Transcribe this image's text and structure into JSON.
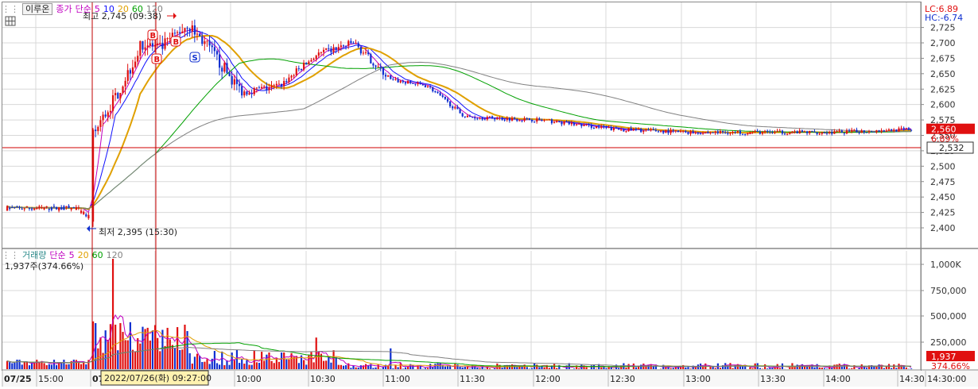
{
  "price_header": {
    "grip": "⋮⋮",
    "tab_label": "이루온",
    "close_label": "종가",
    "ma_label": "단순",
    "periods": [
      "5",
      "10",
      "20",
      "60",
      "120"
    ],
    "period_colors": [
      "#c000c0",
      "#1010ff",
      "#e0a000",
      "#00a000",
      "#808080"
    ],
    "grid_icon_name": "table-icon"
  },
  "corner": {
    "lc": "LC:6.89",
    "hc": "HC:-6.74"
  },
  "annotations": {
    "high": "최고 2,745 (09:38)",
    "low": "최저 2,395 (15:30)",
    "markers": [
      "B",
      "B",
      "B",
      "S"
    ]
  },
  "price_axis": {
    "ticks": [
      "2,725",
      "2,700",
      "2,675",
      "2,650",
      "2,625",
      "2,600",
      "2,575",
      "2,550",
      "2,525",
      "2,500",
      "2,475",
      "2,450",
      "2,425",
      "2,400"
    ],
    "current_price": "2,560",
    "current_pct": "6.89%",
    "crosshair_price": "2,532"
  },
  "volume_header": {
    "label": "거래량",
    "ma_label": "단순",
    "periods": [
      "5",
      "20",
      "60",
      "120"
    ],
    "period_colors": [
      "#c000c0",
      "#e0a000",
      "#00a000",
      "#808080"
    ],
    "current": "1,937주(374.66%)"
  },
  "volume_axis": {
    "ticks": [
      "1,000K",
      "750,000",
      "500,000",
      "250,000"
    ],
    "current_value": "1,937",
    "current_pct": "374.66%"
  },
  "time_axis": {
    "labels": [
      "07/25",
      "15:00",
      "07",
      "10:00",
      "10:30",
      "11:00",
      "11:30",
      "12:00",
      "12:30",
      "13:00",
      "13:30",
      "14:00",
      "14:30",
      "14:30:00"
    ],
    "crosshair_time": "2022/07/26(화) 09:27:00"
  },
  "colors": {
    "up": "#e01010",
    "down": "#1030d0",
    "crosshair": "#d00000",
    "grid": "#d8d8d8"
  },
  "chart_data": {
    "type": "candlestick",
    "title": "이루온",
    "period": "1-minute",
    "session_low": {
      "value": 2395,
      "time": "15:30"
    },
    "session_high": {
      "value": 2745,
      "time": "09:38"
    },
    "close_path": [
      {
        "t": "07/25 14:40",
        "price": 2432
      },
      {
        "t": "07/25 15:00",
        "price": 2428
      },
      {
        "t": "07/25 15:20",
        "price": 2430
      },
      {
        "t": "07/25 15:30",
        "price": 2410
      },
      {
        "t": "09:00",
        "price": 2550
      },
      {
        "t": "09:10",
        "price": 2620
      },
      {
        "t": "09:20",
        "price": 2700
      },
      {
        "t": "09:27",
        "price": 2690
      },
      {
        "t": "09:38",
        "price": 2730
      },
      {
        "t": "09:45",
        "price": 2700
      },
      {
        "t": "10:00",
        "price": 2620
      },
      {
        "t": "10:15",
        "price": 2630
      },
      {
        "t": "10:30",
        "price": 2680
      },
      {
        "t": "10:45",
        "price": 2700
      },
      {
        "t": "11:00",
        "price": 2640
      },
      {
        "t": "11:15",
        "price": 2630
      },
      {
        "t": "11:30",
        "price": 2580
      },
      {
        "t": "12:00",
        "price": 2575
      },
      {
        "t": "12:30",
        "price": 2560
      },
      {
        "t": "13:00",
        "price": 2555
      },
      {
        "t": "13:30",
        "price": 2555
      },
      {
        "t": "14:00",
        "price": 2555
      },
      {
        "t": "14:30",
        "price": 2560
      }
    ],
    "volume_spikes": [
      {
        "t": "09:08",
        "volume": 1050000
      },
      {
        "t": "09:00",
        "volume": 450000
      },
      {
        "t": "09:20",
        "volume": 400000
      },
      {
        "t": "10:30",
        "volume": 300000
      },
      {
        "t": "11:00",
        "volume": 200000
      }
    ],
    "ylim": [
      2380,
      2745
    ],
    "volume_ylim": [
      0,
      1100000
    ]
  }
}
